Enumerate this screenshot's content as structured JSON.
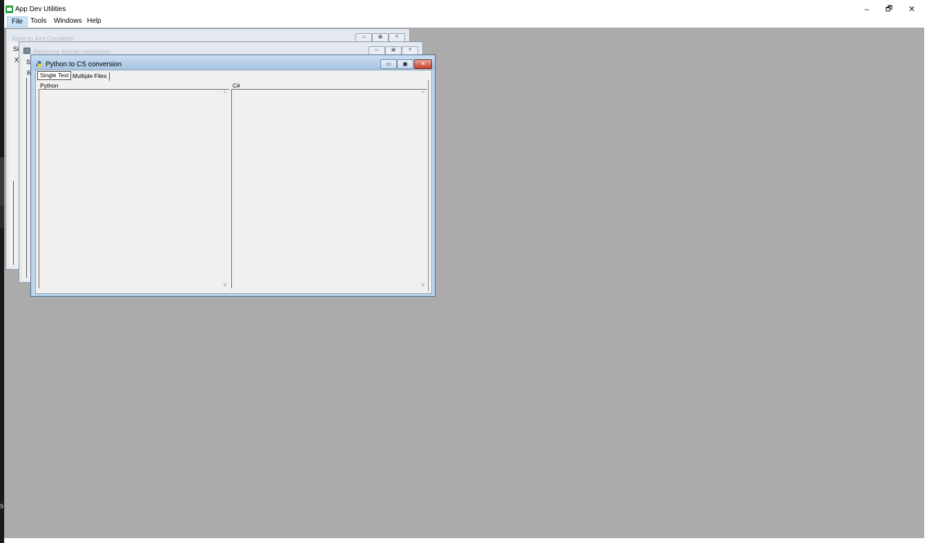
{
  "app": {
    "title": "App Dev Utilities",
    "caption_buttons": {
      "minimize": "–",
      "restore": "🗗",
      "close": "✕"
    }
  },
  "menubar": {
    "items": [
      "File",
      "Tools",
      "Windows",
      "Help"
    ]
  },
  "left_strip": {
    "digit": "9"
  },
  "windows": {
    "back1": {
      "title": "Xaml to Xml Converter",
      "fragments": [
        "Si",
        "X"
      ]
    },
    "back2": {
      "title": "Resource format conversion",
      "fragments": [
        "Si",
        "R"
      ]
    },
    "active": {
      "title": "Python to CS conversion",
      "tabs": [
        "Single Text",
        "Multiple Files"
      ],
      "panes": {
        "left_label": "Python",
        "right_label": "C#"
      }
    }
  },
  "colors": {
    "mdi_background": "#ababab",
    "app_icon": "#1e9e3c",
    "menu_highlight": "#cce4f7",
    "active_caption": "#bed5ea",
    "close_button": "#c7402a"
  },
  "icons": [
    "app-icon",
    "python-icon",
    "form-icon",
    "minimize-icon",
    "restore-icon",
    "close-icon",
    "scroll-up-icon",
    "scroll-down-icon"
  ]
}
